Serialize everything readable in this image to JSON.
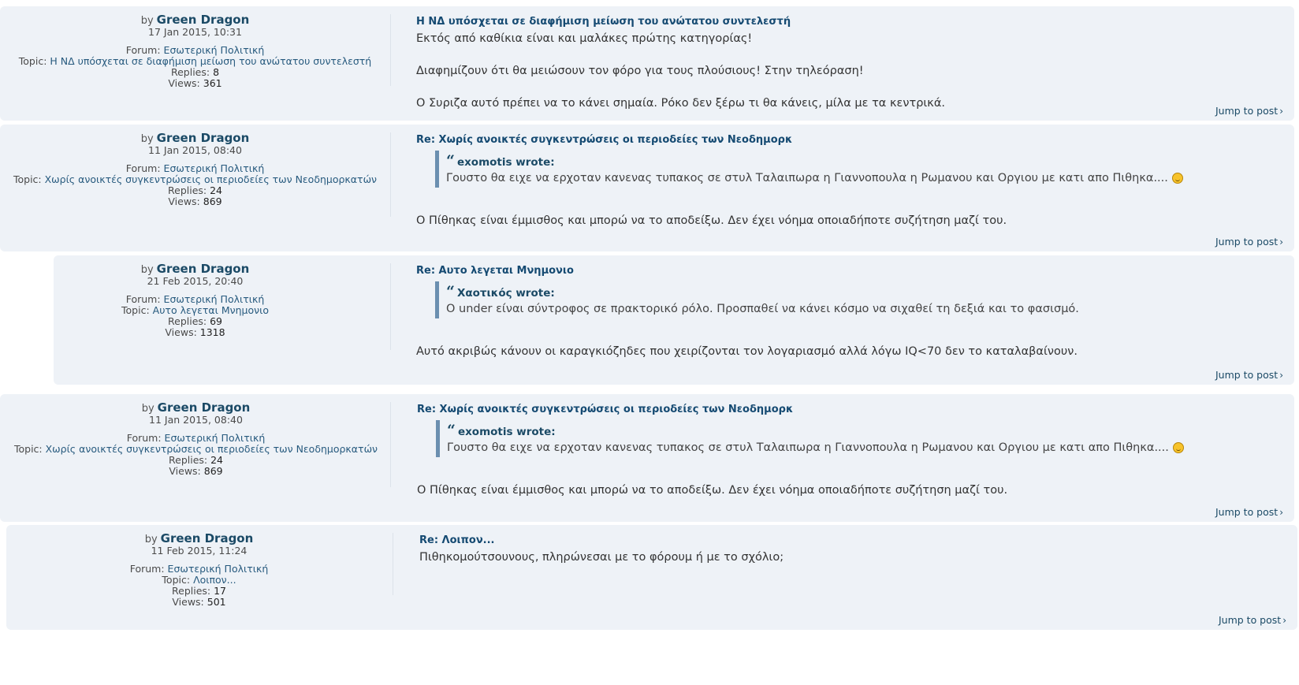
{
  "jump_label": "Jump to post",
  "labels": {
    "by": "by",
    "forum": "Forum:",
    "topic": "Topic:",
    "replies": "Replies:",
    "views": "Views:"
  },
  "posts": [
    {
      "author": "Green Dragon",
      "date": "17 Jan 2015, 10:31",
      "forum": "Εσωτερική Πολιτική",
      "topic": "Η ΝΔ υπόσχεται σε διαφήμιση μείωση του ανώτατου συντελεστή",
      "replies": "8",
      "views": "361",
      "title": "Η ΝΔ υπόσχεται σε διαφήμιση μείωση του ανώτατου συντελεστή",
      "paragraphs": [
        "Εκτός από καθίκια είναι και μαλάκες πρώτης κατηγορίας!",
        "Διαφημίζουν ότι θα μειώσουν τον φόρο για τους πλούσιους! Στην τηλεόραση!",
        "Ο Συριζα αυτό πρέπει να το κάνει σημαία. Ρόκο δεν ξέρω τι θα κάνεις, μίλα με τα κεντρικά."
      ]
    },
    {
      "author": "Green Dragon",
      "date": "11 Jan 2015, 08:40",
      "forum": "Εσωτερική Πολιτική",
      "topic": "Χωρίς ανοικτές συγκεντρώσεις οι περιοδείες των Νεοδημορκατών",
      "replies": "24",
      "views": "869",
      "title": "Re: Χωρίς ανοικτές συγκεντρώσεις οι περιοδείες των Νεοδημορκ",
      "quote_author": "exomotis wrote:",
      "quote_text": "Γουστο θα ειχε να ερχοταν κανενας τυπακος σε στυλ Ταλαιπωρα η Γιαννοπουλα η Ρωμανου και Οργιου με κατι απο Πιθηκα....",
      "paragraphs": [
        "Ο Πίθηκας είναι έμμισθος και μπορώ να το αποδείξω. Δεν έχει νόημα οποιαδήποτε συζήτηση μαζί του."
      ]
    },
    {
      "author": "Green Dragon",
      "date": "21 Feb 2015, 20:40",
      "forum": "Εσωτερική Πολιτική",
      "topic": "Αυτο λεγεται Μνημονιο",
      "replies": "69",
      "views": "1318",
      "title": "Re: Αυτο λεγεται Μνημονιο",
      "quote_author": "Χαοτικός wrote:",
      "quote_text": "Ο under είναι σύντροφος σε πρακτορικό ρόλο. Προσπαθεί να κάνει κόσμο να σιχαθεί τη δεξιά και το φασισμό.",
      "paragraphs": [
        "Αυτό ακριβώς κάνουν οι καραγκιόζηδες που χειρίζονται τον λογαριασμό αλλά λόγω IQ<70 δεν το καταλαβαίνουν."
      ]
    },
    {
      "author": "Green Dragon",
      "date": "11 Jan 2015, 08:40",
      "forum": "Εσωτερική Πολιτική",
      "topic": "Χωρίς ανοικτές συγκεντρώσεις οι περιοδείες των Νεοδημορκατών",
      "replies": "24",
      "views": "869",
      "title": "Re: Χωρίς ανοικτές συγκεντρώσεις οι περιοδείες των Νεοδημορκ",
      "quote_author": "exomotis wrote:",
      "quote_text": "Γουστο θα ειχε να ερχοταν κανενας τυπακος σε στυλ Ταλαιπωρα η Γιαννοπουλα η Ρωμανου και Οργιου με κατι απο Πιθηκα....",
      "paragraphs": [
        "Ο Πίθηκας είναι έμμισθος και μπορώ να το αποδείξω. Δεν έχει νόημα οποιαδήποτε συζήτηση μαζί του."
      ]
    },
    {
      "author": "Green Dragon",
      "date": "11 Feb 2015, 11:24",
      "forum": "Εσωτερική Πολιτική",
      "topic": "Λοιπον...",
      "replies": "17",
      "views": "501",
      "title": "Re: Λοιπον...",
      "paragraphs": [
        "Πιθηκομούτσουνους, πληρώνεσαι με το φόρουμ ή με το σχόλιο;"
      ]
    }
  ]
}
